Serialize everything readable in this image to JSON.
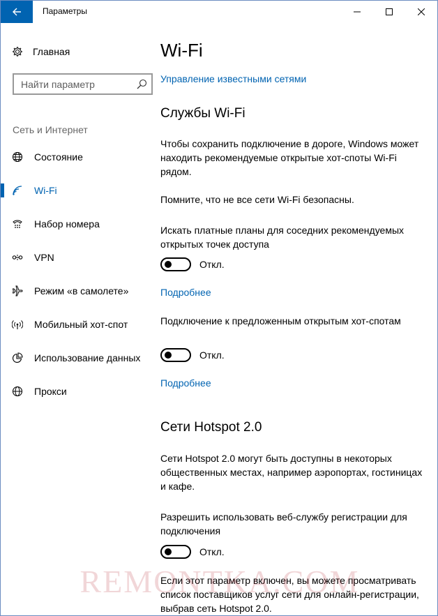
{
  "window": {
    "title": "Параметры"
  },
  "sidebar": {
    "home_label": "Главная",
    "search_placeholder": "Найти параметр",
    "section_label": "Сеть и Интернет",
    "items": [
      {
        "label": "Состояние",
        "icon": "globe-icon"
      },
      {
        "label": "Wi-Fi",
        "icon": "wifi-icon",
        "active": true
      },
      {
        "label": "Набор номера",
        "icon": "dialup-icon"
      },
      {
        "label": "VPN",
        "icon": "vpn-icon"
      },
      {
        "label": "Режим «в самолете»",
        "icon": "airplane-icon"
      },
      {
        "label": "Мобильный хот-спот",
        "icon": "hotspot-icon"
      },
      {
        "label": "Использование данных",
        "icon": "data-usage-icon"
      },
      {
        "label": "Прокси",
        "icon": "proxy-icon"
      }
    ]
  },
  "main": {
    "title": "Wi-Fi",
    "manage_link": "Управление известными сетями",
    "wifi_services": {
      "heading": "Службы Wi-Fi",
      "description": "Чтобы сохранить подключение в дороге, Windows может находить рекомендуемые открытые хот-споты Wi-Fi рядом.",
      "warning": "Помните, что не все сети Wi-Fi безопасны.",
      "paid_plans": {
        "label": "Искать платные планы для соседних рекомендуемых открытых точек доступа",
        "state": "Откл.",
        "more_link": "Подробнее"
      },
      "suggested_hotspots": {
        "label": "Подключение к предложенным открытым хот-спотам",
        "state": "Откл.",
        "more_link": "Подробнее"
      }
    },
    "hotspot20": {
      "heading": "Сети Hotspot 2.0",
      "description": "Сети Hotspot 2.0 могут быть доступны в некоторых общественных местах, например аэропортах, гостиницах и кафе.",
      "signup": {
        "label": "Разрешить использовать веб-службу регистрации для подключения",
        "state": "Откл."
      },
      "footer": "Если этот параметр включен, вы можете просматривать список поставщиков услуг сети для онлайн-регистрации, выбрав сеть Hotspot 2.0."
    }
  },
  "watermark": "REMONTKA.COM",
  "colors": {
    "accent": "#0063b1",
    "text": "#000000",
    "secondary_text": "#666666"
  }
}
